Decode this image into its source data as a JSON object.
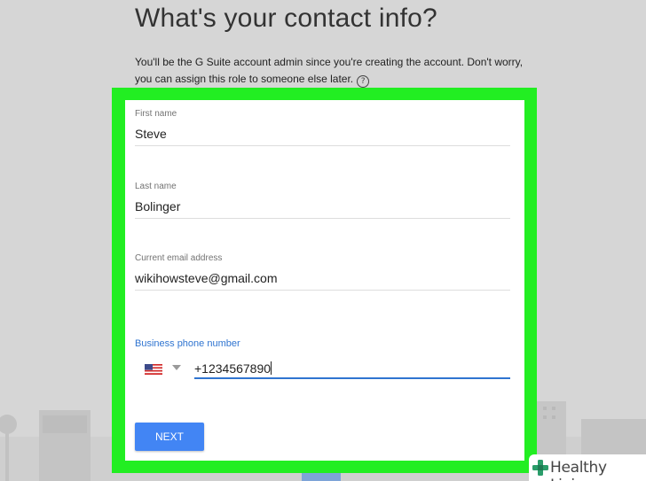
{
  "page": {
    "heading": "What's your contact info?",
    "intro": "You'll be the G Suite account admin since you're creating the account. Don't worry, you can assign this role to someone else later.",
    "help_icon": "question-circle-icon"
  },
  "form": {
    "first_name": {
      "label": "First name",
      "value": "Steve"
    },
    "last_name": {
      "label": "Last name",
      "value": "Bolinger"
    },
    "email": {
      "label": "Current email address",
      "value": "wikihowsteve@gmail.com"
    },
    "phone": {
      "label": "Business phone number",
      "country_flag": "us-flag-icon",
      "value": "+1234567890"
    },
    "next_label": "NEXT"
  },
  "watermark": {
    "text": "Healthy Living"
  },
  "colors": {
    "highlight": "#22ee22",
    "primary_blue": "#4285f4",
    "focus_blue": "#2f74d0",
    "background": "#d6d6d6"
  }
}
